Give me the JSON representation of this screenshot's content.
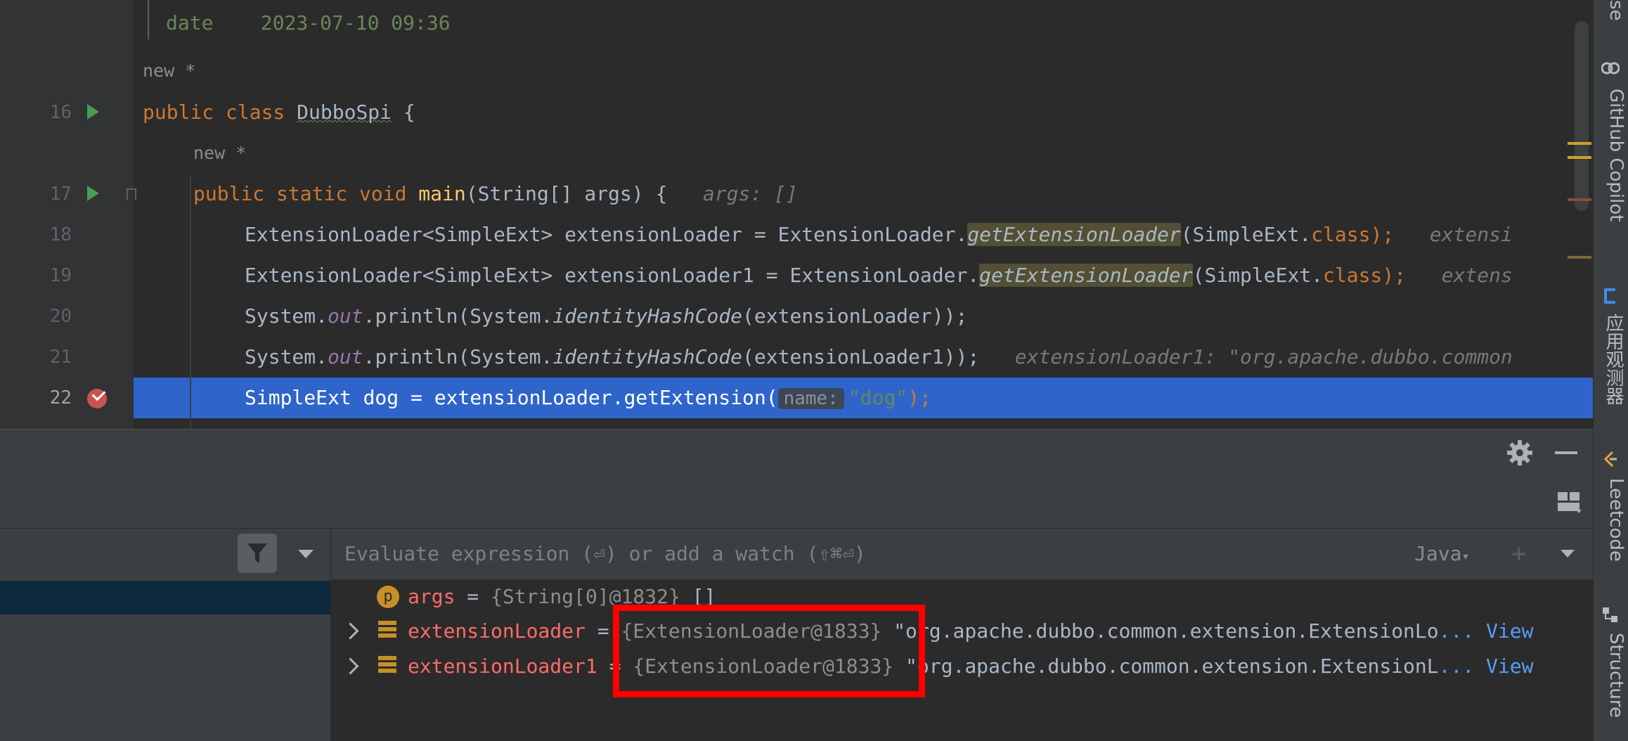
{
  "editor": {
    "lines": [
      {
        "num": "",
        "author": "",
        "text": "date    2023-07-10 09:36"
      },
      {
        "num": "",
        "author": "new *"
      },
      {
        "num": "16",
        "kw1": "public class ",
        "cls": "DubboSpi",
        "rest": " {"
      },
      {
        "num": "",
        "author": "new *"
      },
      {
        "num": "17",
        "kw1": "public static void ",
        "fn": "main",
        "rest": "(String[] args) {",
        "hint": "args: []"
      },
      {
        "num": "18",
        "p1": "ExtensionLoader<SimpleExt> extensionLoader = ExtensionLoader.",
        "m": "getExtensionLoader",
        "p2": "(SimpleExt.",
        "k": "class",
        "p3": ");",
        "hint": "extensi"
      },
      {
        "num": "19",
        "p1": "ExtensionLoader<SimpleExt> extensionLoader1 = ExtensionLoader.",
        "m": "getExtensionLoader",
        "p2": "(SimpleExt.",
        "k": "class",
        "p3": ");",
        "hint": "extens"
      },
      {
        "num": "20",
        "p1": "System.",
        "st": "out",
        "p2": ".println(System.",
        "m": "identityHashCode",
        "p3": "(extensionLoader));"
      },
      {
        "num": "21",
        "p1": "System.",
        "st": "out",
        "p2": ".println(System.",
        "m": "identityHashCode",
        "p3": "(extensionLoader1));",
        "hint": "extensionLoader1: \"org.apache.dubbo.common"
      },
      {
        "num": "22",
        "p1": "SimpleExt dog = extensionLoader.getExtension(",
        "param": "name:",
        "s": "\"dog\"",
        "p3": ");"
      }
    ]
  },
  "evaluate": {
    "placeholder": "Evaluate expression (⏎) or add a watch (⇧⌘⏎)",
    "lang": "Java"
  },
  "variables": [
    {
      "name": "args",
      "eq": " = ",
      "obj": "{String[0]@1832}",
      "val": " []",
      "icon": "p",
      "expandable": false
    },
    {
      "name": "extensionLoader",
      "eq": " = ",
      "obj": "{ExtensionLoader@1833}",
      "val": " \"org.apache.dubbo.common.extension.ExtensionLo",
      "link": "... View",
      "expandable": true
    },
    {
      "name": "extensionLoader1",
      "eq": " = ",
      "obj": "{ExtensionLoader@1833}",
      "val": " \"org.apache.dubbo.common.extension.ExtensionL",
      "link": "... View",
      "expandable": true
    }
  ],
  "right_tools": [
    "se",
    "GitHub Copilot",
    "应用观测器",
    "Leetcode",
    "Structure"
  ],
  "colors": {
    "selection": "#2f65ca",
    "highlight_box": "#ff0000"
  }
}
